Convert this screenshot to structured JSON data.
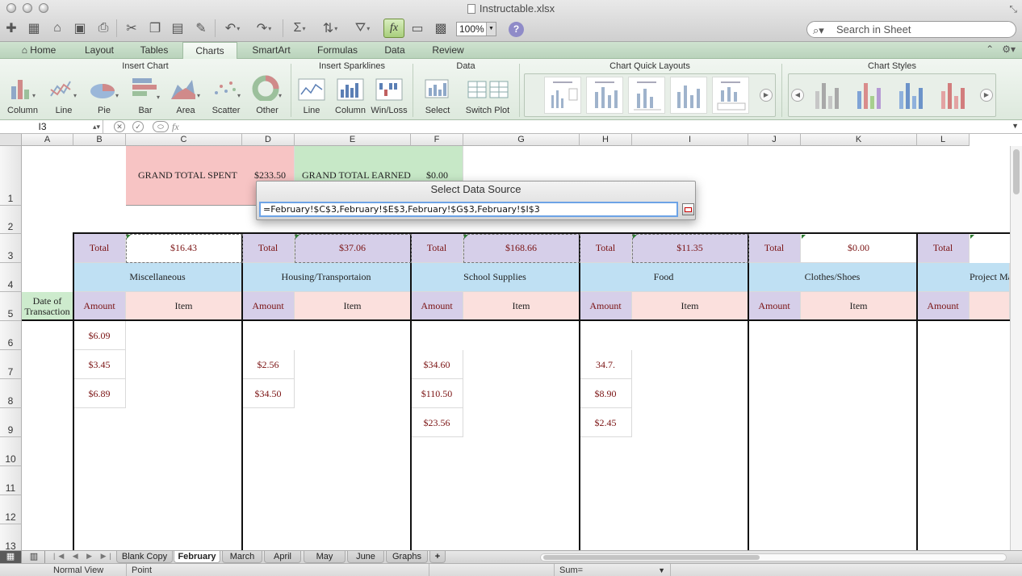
{
  "window": {
    "title": "Instructable.xlsx"
  },
  "toolbar": {
    "zoom": "100%",
    "fx_label": "fx",
    "help_label": "?",
    "search_placeholder": "Search in Sheet"
  },
  "ribbon": {
    "tabs": [
      {
        "label": "Home",
        "active": false
      },
      {
        "label": "Layout",
        "active": false
      },
      {
        "label": "Tables",
        "active": false
      },
      {
        "label": "Charts",
        "active": true
      },
      {
        "label": "SmartArt",
        "active": false
      },
      {
        "label": "Formulas",
        "active": false
      },
      {
        "label": "Data",
        "active": false
      },
      {
        "label": "Review",
        "active": false
      }
    ],
    "groups": {
      "insert_chart": "Insert Chart",
      "insert_sparklines": "Insert Sparklines",
      "data": "Data",
      "chart_quick_layouts": "Chart Quick Layouts",
      "chart_styles": "Chart Styles"
    },
    "chart_buttons": [
      "Column",
      "Line",
      "Pie",
      "Bar",
      "Area",
      "Scatter",
      "Other"
    ],
    "sparkline_buttons": [
      "Line",
      "Column",
      "Win/Loss"
    ],
    "data_buttons": [
      "Select",
      "Switch Plot"
    ]
  },
  "formula_bar": {
    "cell_ref": "I3",
    "fx": "fx",
    "content": ""
  },
  "grid": {
    "columns": [
      "A",
      "B",
      "C",
      "D",
      "E",
      "F",
      "G",
      "H",
      "I",
      "J",
      "K",
      "L"
    ],
    "rows": [
      "1",
      "2",
      "3",
      "4",
      "5",
      "6",
      "7",
      "8",
      "9",
      "10",
      "11",
      "12",
      "13"
    ],
    "row1": {
      "grand_total_spent_label": "GRAND TOTAL SPENT",
      "grand_total_spent": "$233.50",
      "grand_total_earned_label": "GRAND TOTAL EARNED",
      "grand_total_earned": "$0.00"
    },
    "total_label": "Total",
    "totals": [
      "$16.43",
      "$37.06",
      "$168.66",
      "$11.35",
      "$0.00"
    ],
    "categories": [
      "Miscellaneous",
      "Housing/Transportaion",
      "School Supplies",
      "Food",
      "Clothes/Shoes",
      "Project Ma"
    ],
    "amount_label": "Amount",
    "item_label": "Item",
    "date_label": "Date of Transaction",
    "amounts": {
      "B": [
        "$6.09",
        "$3.45",
        "$6.89"
      ],
      "D": [
        "",
        "$2.56",
        "$34.50"
      ],
      "F": [
        "",
        "$34.60",
        "$110.50",
        "$23.56"
      ],
      "H": [
        "",
        "34.7.",
        "$8.90",
        "$2.45"
      ]
    }
  },
  "dialog": {
    "title": "Select Data Source",
    "value": "=February!$C$3,February!$E$3,February!$G$3,February!$I$3"
  },
  "sheets": [
    {
      "label": "Blank Copy",
      "active": false
    },
    {
      "label": "February",
      "active": true
    },
    {
      "label": "March",
      "active": false
    },
    {
      "label": "April",
      "active": false
    },
    {
      "label": "May",
      "active": false
    },
    {
      "label": "June",
      "active": false
    },
    {
      "label": "Graphs",
      "active": false
    }
  ],
  "add_sheet_label": "+",
  "status": {
    "view": "Normal View",
    "mode": "Point",
    "sum": "Sum="
  },
  "colors": {
    "header_purple": "#d6cfe9",
    "header_blue": "#bfe0f3",
    "header_pink": "#fbe0dd",
    "spent_red": "#f7c4c4",
    "earned_green": "#c7e8c7",
    "date_green": "#cdebcd",
    "money_text": "#7a1212",
    "ribbon_green": "#cfe3d0"
  }
}
